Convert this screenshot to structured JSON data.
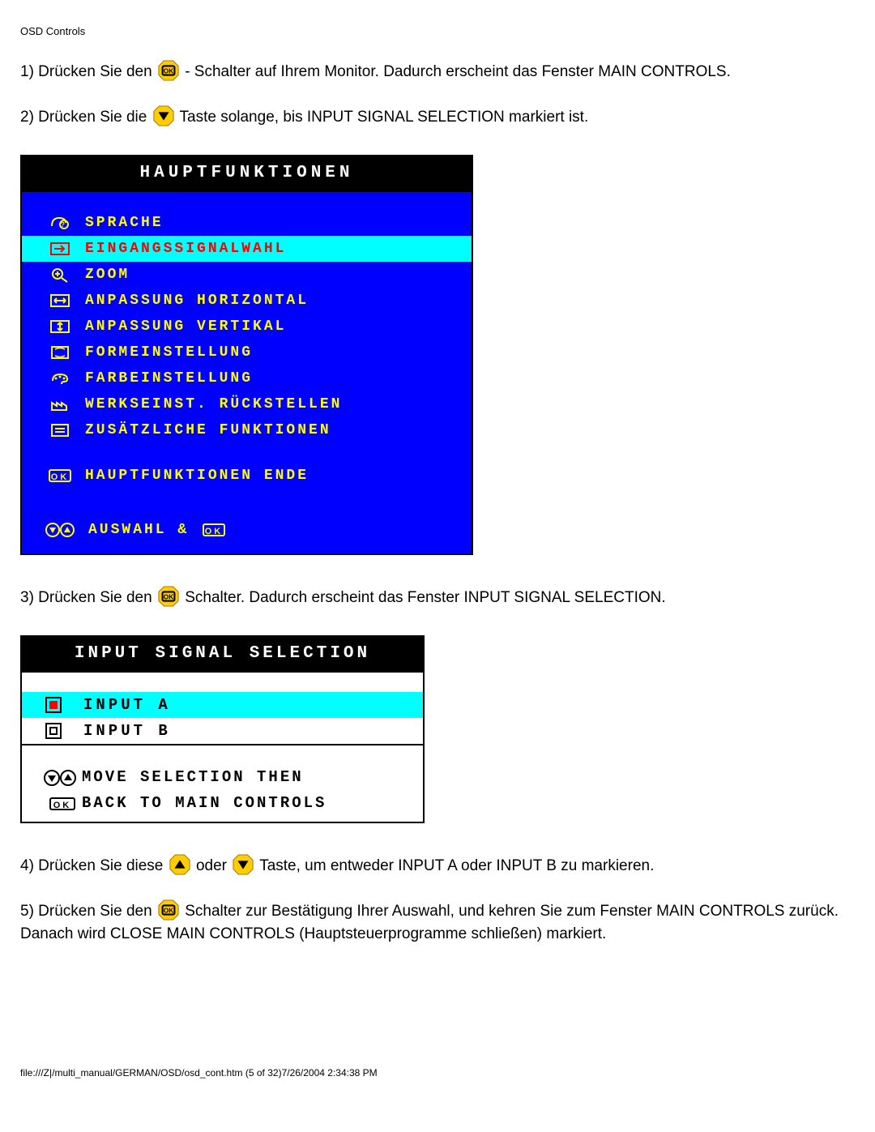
{
  "page_header": "OSD Controls",
  "step1_a": "1) Drücken Sie den ",
  "step1_b": " - Schalter auf Ihrem Monitor. Dadurch erscheint das Fenster MAIN CONTROLS.",
  "step2_a": "2) Drücken Sie die ",
  "step2_b": " Taste solange, bis INPUT SIGNAL SELECTION markiert ist.",
  "osd1": {
    "title": "HAUPTFUNKTIONEN",
    "items": [
      "SPRACHE",
      "EINGANGSSIGNALWAHL",
      "ZOOM",
      "ANPASSUNG HORIZONTAL",
      "ANPASSUNG VERTIKAL",
      "FORMEINSTELLUNG",
      "FARBEINSTELLUNG",
      "WERKSEINST. RÜCKSTELLEN",
      "ZUSÄTZLICHE FUNKTIONEN"
    ],
    "close_label": "HAUPTFUNKTIONEN ENDE",
    "footer_label": "AUSWAHL &"
  },
  "step3_a": "3) Drücken Sie den ",
  "step3_b": " Schalter. Dadurch erscheint das Fenster INPUT SIGNAL SELECTION.",
  "osd2": {
    "title": "INPUT SIGNAL SELECTION",
    "items": [
      "INPUT A",
      "INPUT B"
    ],
    "foot1": "MOVE SELECTION THEN",
    "foot2": "BACK TO MAIN CONTROLS"
  },
  "step4_a": "4) Drücken Sie diese ",
  "step4_b": " oder ",
  "step4_c": " Taste, um entweder INPUT A oder INPUT B zu markieren.",
  "step5_a": "5) Drücken Sie den ",
  "step5_b": " Schalter zur Bestätigung Ihrer Auswahl, und kehren Sie zum Fenster MAIN CONTROLS zurück. Danach wird CLOSE MAIN CONTROLS (Hauptsteuerprogramme schließen) markiert.",
  "page_footer": "file:///Z|/multi_manual/GERMAN/OSD/osd_cont.htm (5 of 32)7/26/2004 2:34:38 PM"
}
